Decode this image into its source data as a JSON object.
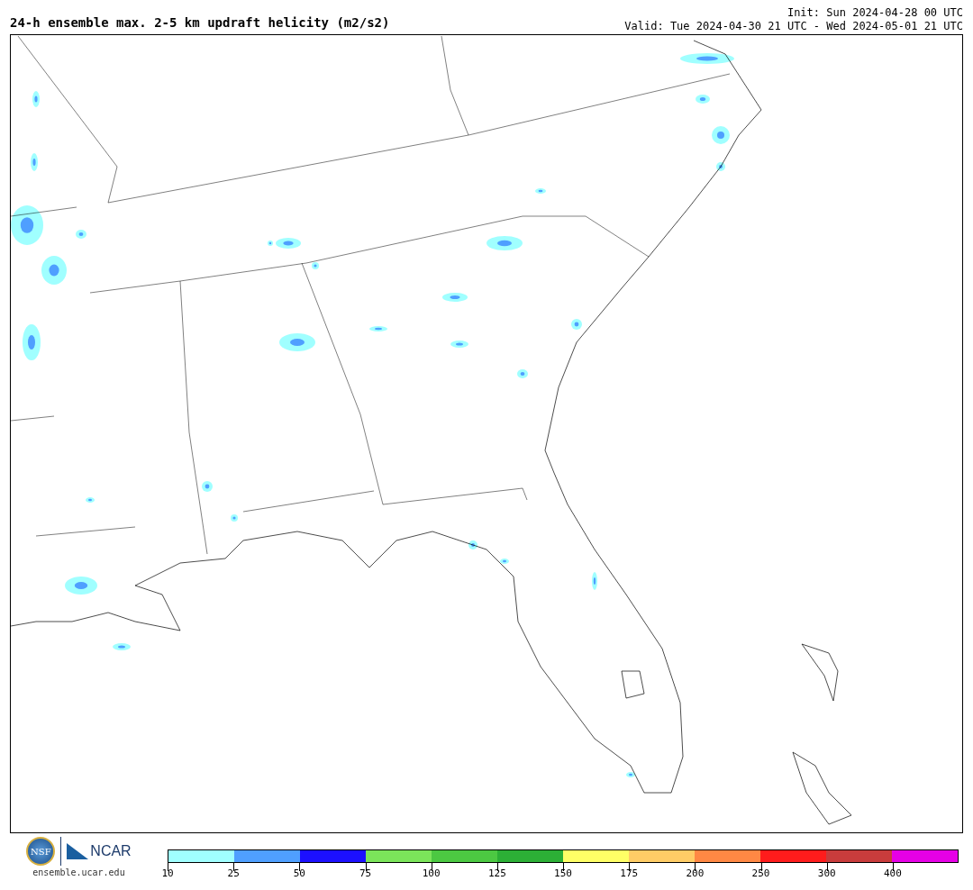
{
  "title": "24-h ensemble max. 2-5 km updraft helicity (m2/s2)",
  "init": "Init: Sun 2024-04-28 00 UTC",
  "valid": "Valid: Tue 2024-04-30 21 UTC - Wed 2024-05-01 21 UTC",
  "logos": {
    "nsf": "NSF",
    "ncar": "NCAR",
    "url": "ensemble.ucar.edu"
  },
  "colorbar": [
    {
      "label": "10",
      "color": "#a0ffff"
    },
    {
      "label": "25",
      "color": "#4f9fff"
    },
    {
      "label": "50",
      "color": "#1c10ff"
    },
    {
      "label": "75",
      "color": "#7be45a"
    },
    {
      "label": "100",
      "color": "#4cc842"
    },
    {
      "label": "125",
      "color": "#2caf36"
    },
    {
      "label": "150",
      "color": "#ffff66"
    },
    {
      "label": "175",
      "color": "#ffcc66"
    },
    {
      "label": "200",
      "color": "#ff8844"
    },
    {
      "label": "250",
      "color": "#ff1c1c"
    },
    {
      "label": "300",
      "color": "#c83c3c"
    },
    {
      "label": "400",
      "color": "#e600e6"
    }
  ]
}
